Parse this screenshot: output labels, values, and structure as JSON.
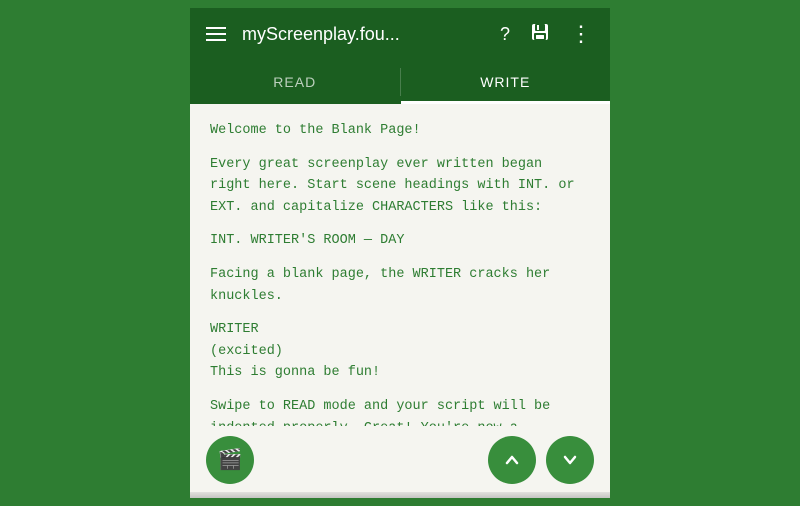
{
  "topbar": {
    "title": "myScreenplay.fou...",
    "hamburger_label": "Menu",
    "help_icon": "?",
    "save_icon": "💾",
    "more_icon": "⋮"
  },
  "tabs": [
    {
      "id": "read",
      "label": "READ",
      "active": false
    },
    {
      "id": "write",
      "label": "WRITE",
      "active": true
    }
  ],
  "content": {
    "line1": "Welcome to the Blank Page!",
    "line2": "Every great screenplay ever written began right here. Start scene headings with INT. or EXT. and capitalize CHARACTERS like this:",
    "line3": "INT. WRITER'S ROOM — DAY",
    "line4": "Facing a blank page, the WRITER cracks her knuckles.",
    "line5": "WRITER\n(excited)\nThis is gonna be fun!",
    "line6": "Swipe to READ mode and your script will be indented properly. Great! You're now a screenplay-formatting expert! For more writing tips, check the side drawer."
  },
  "buttons": {
    "movie_icon": "🎬",
    "up_arrow": "^",
    "down_arrow": "v"
  }
}
